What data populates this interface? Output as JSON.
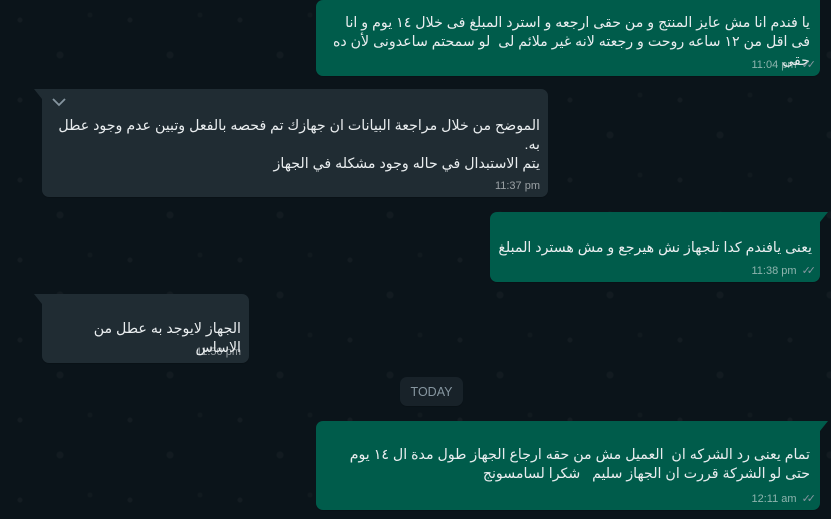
{
  "conversation": {
    "date_separator": "TODAY",
    "messages": [
      {
        "direction": "outgoing",
        "text": "يا فندم انا مش عايز المنتج و من حقى ارجعه و استرد المبلغ فى خلال ١٤ يوم و انا فى اقل من ١٢ ساعه روحت و رجعته لانه غير ملائم لى  لو سمحتم ساعدونى لأن ده حقى",
        "time": "11:04 pm",
        "status": "read"
      },
      {
        "direction": "incoming",
        "text": "الموضح من خلال مراجعة البيانات ان جهازك تم فحصه بالفعل وتبين عدم وجود عطل به.\nيتم الاستبدال في حاله وجود مشكله في الجهاز",
        "time": "11:37 pm"
      },
      {
        "direction": "outgoing",
        "text": "يعنى يافندم كدا تلجهاز نش هيرجع و مش هسترد المبلغ",
        "time": "11:38 pm",
        "status": "read"
      },
      {
        "direction": "incoming",
        "text": "الجهاز لايوجد به عطل من الاساس",
        "time": "11:50 pm"
      },
      {
        "direction": "outgoing",
        "text": "تمام يعنى رد الشركه ان  العميل مش من حقه ارجاع الجهاز طول مدة ال ١٤ يوم حتى لو الشركة قررت ان الجهاز سليم   شكرا لسامسونج",
        "time": "12:11 am",
        "status": "read"
      }
    ]
  },
  "icons": {
    "read_receipt": "double-check-icon",
    "menu_chevron": "chevron-down-icon"
  },
  "colors": {
    "background": "#0b141a",
    "outgoing_bubble": "#005c4b",
    "incoming_bubble": "#202c33",
    "date_pill": "#182229",
    "text": "#e9edef",
    "meta_text": "#8696a0"
  }
}
